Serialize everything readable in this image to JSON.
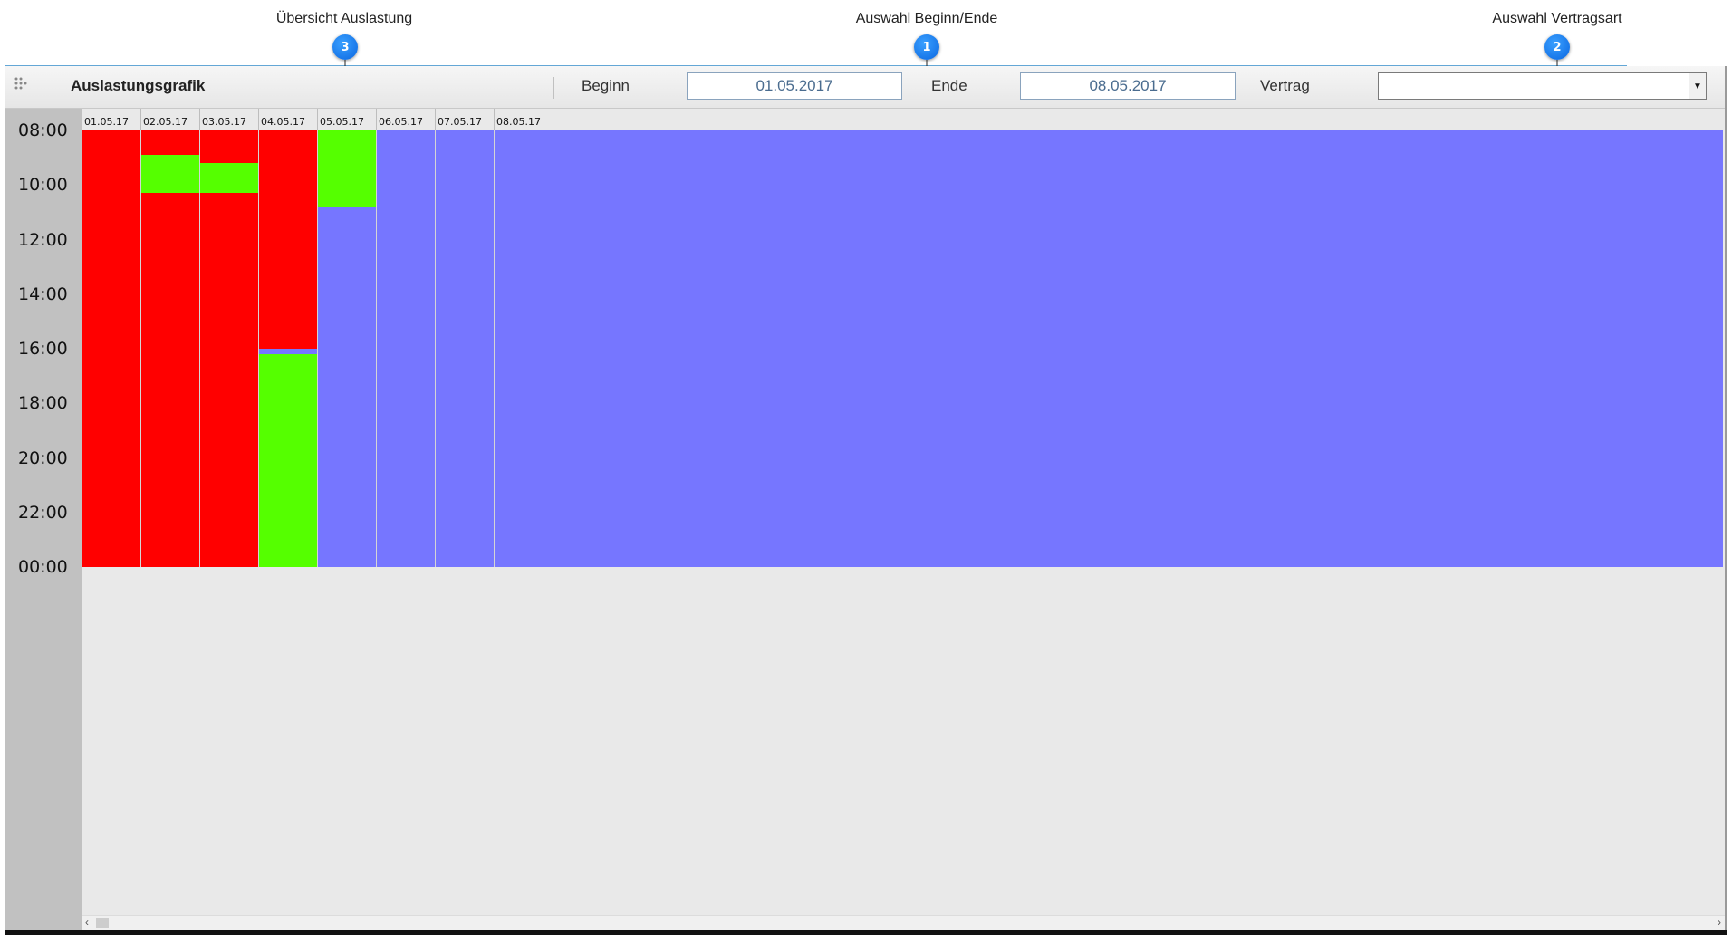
{
  "callouts": [
    {
      "number": "3",
      "label": "Übersicht Auslastung"
    },
    {
      "number": "1",
      "label": "Auswahl Beginn/Ende"
    },
    {
      "number": "2",
      "label": "Auswahl Vertragsart"
    }
  ],
  "toolbar": {
    "title": "Auslastungsgrafik",
    "begin_label": "Beginn",
    "begin_value": "01.05.2017",
    "end_label": "Ende",
    "end_value": "08.05.2017",
    "contract_label": "Vertrag",
    "contract_value": "",
    "dropdown_icon": "chevron-down-icon",
    "grip_icon": "drag-handle-icon"
  },
  "colors": {
    "occupied": "#ff0000",
    "free": "#55ff00",
    "unavailable": "#7676ff"
  },
  "chart_data": {
    "type": "heatmap",
    "y_ticks": [
      "08:00",
      "10:00",
      "12:00",
      "14:00",
      "16:00",
      "18:00",
      "20:00",
      "22:00",
      "00:00"
    ],
    "y_range_hours": [
      8,
      24
    ],
    "days": [
      {
        "label": "01.05.17",
        "segments": [
          {
            "from": 8,
            "to": 24,
            "state": "occupied"
          }
        ]
      },
      {
        "label": "02.05.17",
        "segments": [
          {
            "from": 8,
            "to": 8.9,
            "state": "occupied"
          },
          {
            "from": 8.9,
            "to": 10.3,
            "state": "free"
          },
          {
            "from": 10.3,
            "to": 24,
            "state": "occupied"
          }
        ]
      },
      {
        "label": "03.05.17",
        "segments": [
          {
            "from": 8,
            "to": 9.2,
            "state": "occupied"
          },
          {
            "from": 9.2,
            "to": 10.3,
            "state": "free"
          },
          {
            "from": 10.3,
            "to": 24,
            "state": "occupied"
          }
        ]
      },
      {
        "label": "04.05.17",
        "segments": [
          {
            "from": 8,
            "to": 16,
            "state": "occupied"
          },
          {
            "from": 16,
            "to": 16.2,
            "state": "unavailable"
          },
          {
            "from": 16.2,
            "to": 24,
            "state": "free"
          }
        ]
      },
      {
        "label": "05.05.17",
        "segments": [
          {
            "from": 8,
            "to": 10.8,
            "state": "free"
          },
          {
            "from": 10.8,
            "to": 24,
            "state": "unavailable"
          }
        ]
      },
      {
        "label": "06.05.17",
        "segments": [
          {
            "from": 8,
            "to": 24,
            "state": "unavailable"
          }
        ]
      },
      {
        "label": "07.05.17",
        "segments": [
          {
            "from": 8,
            "to": 24,
            "state": "unavailable"
          }
        ]
      },
      {
        "label": "08.05.17",
        "segments": [
          {
            "from": 8,
            "to": 24,
            "state": "unavailable"
          }
        ]
      }
    ]
  }
}
